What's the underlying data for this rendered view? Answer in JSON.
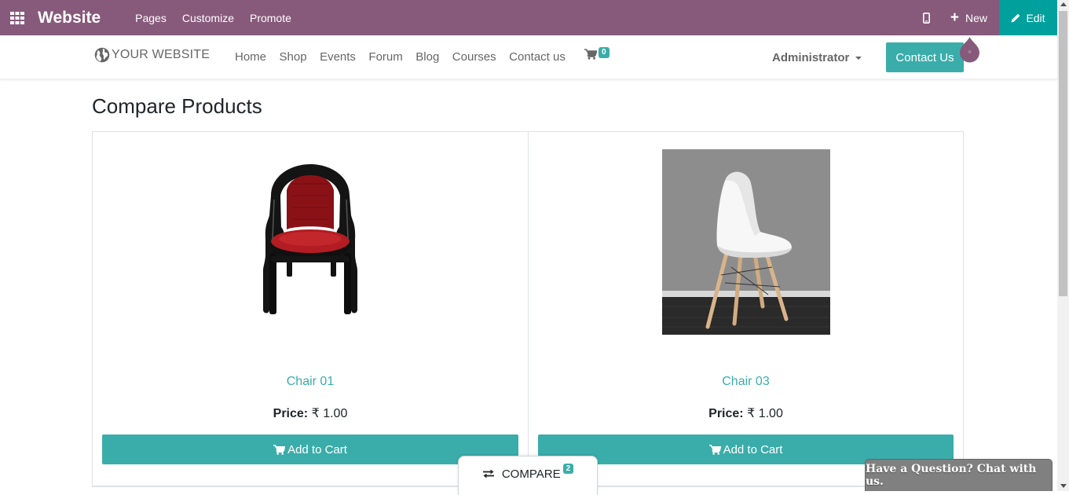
{
  "topbar": {
    "app_title": "Website",
    "menu": [
      "Pages",
      "Customize",
      "Promote"
    ],
    "new_label": "New",
    "edit_label": "Edit"
  },
  "header": {
    "logo_text": "YOUR WEBSITE",
    "nav": [
      "Home",
      "Shop",
      "Events",
      "Forum",
      "Blog",
      "Courses",
      "Contact us"
    ],
    "cart_count": "0",
    "user": "Administrator",
    "contact_button": "Contact Us"
  },
  "page": {
    "title": "Compare Products",
    "products": [
      {
        "name": "Chair 01",
        "price_label": "Price:",
        "price_value": " ₹ 1.00",
        "add_to_cart": "Add to Cart"
      },
      {
        "name": "Chair 03",
        "price_label": "Price:",
        "price_value": " ₹ 1.00",
        "add_to_cart": "Add to Cart"
      }
    ]
  },
  "compare_tab": {
    "label": "COMPARE",
    "count": "2"
  },
  "chat": {
    "label": "Have a Question? Chat with us."
  },
  "colors": {
    "topbar": "#875a7b",
    "edit": "#00a09d",
    "accent": "#3aadaa"
  }
}
